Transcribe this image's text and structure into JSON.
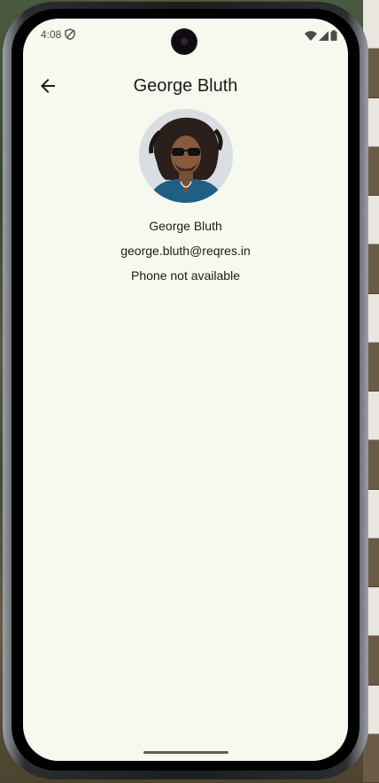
{
  "status_bar": {
    "time": "4:08",
    "icons": [
      "shield-icon",
      "wifi-icon",
      "signal-icon",
      "battery-icon"
    ]
  },
  "app_bar": {
    "title": "George Bluth",
    "back_icon": "arrow-back-icon"
  },
  "profile": {
    "name": "George Bluth",
    "email": "george.bluth@reqres.in",
    "phone": "Phone not available"
  },
  "colors": {
    "screen_background": "#f7f9ef",
    "text": "#1a1c18"
  }
}
